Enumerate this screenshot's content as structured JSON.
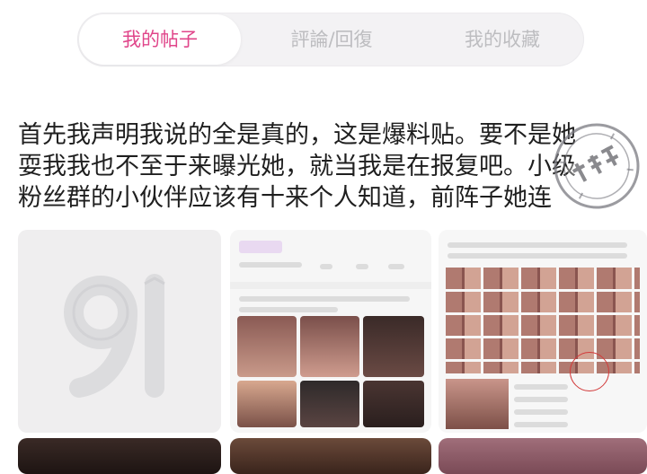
{
  "tabs": [
    {
      "label": "我的帖子",
      "active": true
    },
    {
      "label": "評論/回復",
      "active": false
    },
    {
      "label": "我的收藏",
      "active": false
    }
  ],
  "post": {
    "lines": [
      "首先我声明我说的全是真的，这是爆料贴。要不是她",
      "耍我我也不至于来曝光她，就当我是在报复吧。小级",
      "粉丝群的小伙伴应该有十来个人知道，前阵子她连"
    ]
  },
  "thumbnails": {
    "first_logo_text": "91"
  },
  "colors": {
    "accent": "#e0458a",
    "inactive_tab": "#bdbdc0",
    "body_text": "#1f1f1f",
    "stamp": "#7a7a80",
    "annotation_circle": "#d23a3a"
  },
  "icons": [
    "watermark-stamp-icon",
    "logo-91-icon"
  ]
}
